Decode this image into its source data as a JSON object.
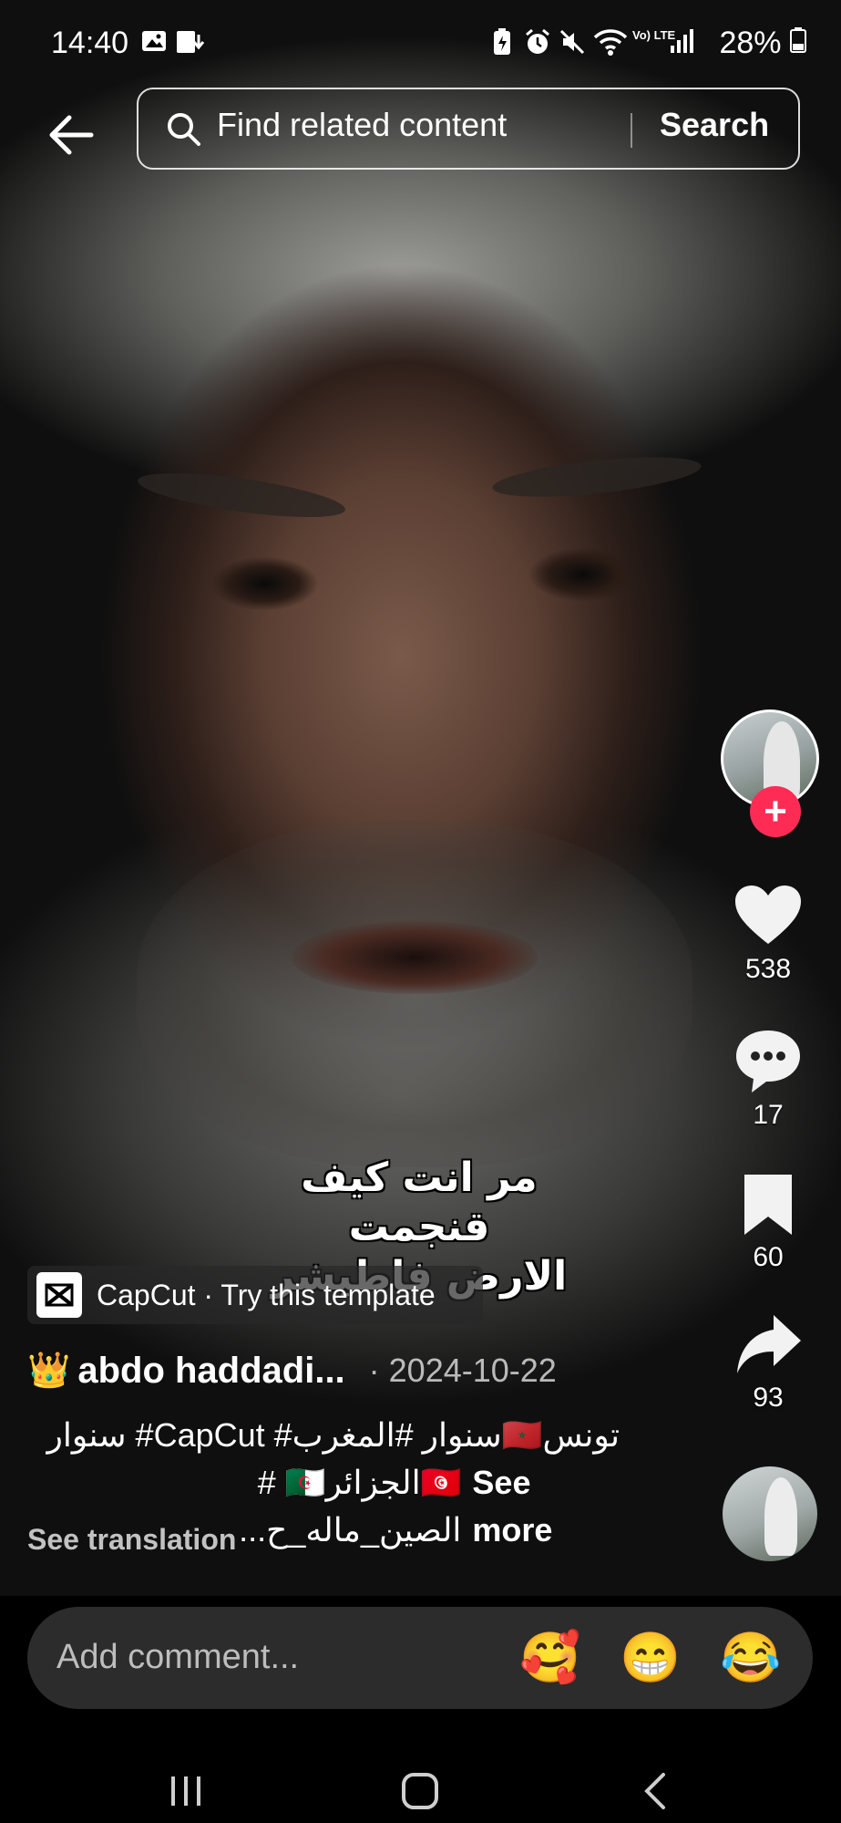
{
  "status_bar": {
    "time": "14:40",
    "signal_text": "Vo) LTE",
    "battery": "28%"
  },
  "search": {
    "placeholder": "Find related content",
    "button_label": "Search"
  },
  "video": {
    "overlay_text_line1": "مر انت كيف قنجمت",
    "overlay_text_line2": "الارض فاطيشر"
  },
  "side_actions": {
    "likes": "538",
    "comments": "17",
    "saves": "60",
    "shares": "93",
    "follow_symbol": "+"
  },
  "capcut": {
    "label": "CapCut · Try this template"
  },
  "post": {
    "author_emoji": "👑",
    "author": "abdo haddadi...",
    "date": "· 2024-10-22",
    "caption_line1": "تونس🇲🇦سنوار #المغرب# CapCut# سنوار",
    "caption_line2": "🇹🇳الجزائر🇩🇿 # الصين_ماله_ح...",
    "see_more": "See more",
    "see_translation": "See translation"
  },
  "comment": {
    "placeholder": "Add comment...",
    "emojis": [
      "🥰",
      "😁",
      "😂"
    ]
  },
  "colors": {
    "follow_red": "#fe2c55",
    "comment_bg": "#2c2c2c"
  }
}
